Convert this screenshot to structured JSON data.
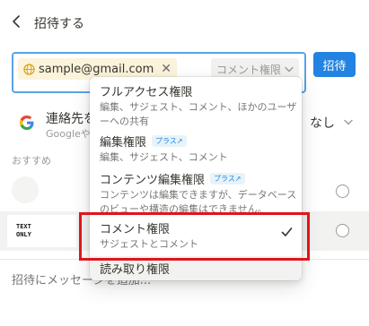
{
  "header": {
    "title": "招待する"
  },
  "invite": {
    "email": "sample@gmail.com",
    "remove_glyph": "✕",
    "permission": "コメント権限",
    "button": "招待"
  },
  "contacts": {
    "title": "連絡先を",
    "subtitle": "GoogleやS",
    "permission": "なし"
  },
  "recommended": {
    "label": "おすすめ"
  },
  "text_only_avatar": {
    "line1": "TEXT",
    "line2": "ONLY"
  },
  "message": {
    "placeholder": "招待にメッセージを追加..."
  },
  "dropdown": {
    "options": [
      {
        "title": "フルアクセス権限",
        "desc": "編集、サジェスト、コメント、ほかのユーザーへの共有"
      },
      {
        "title": "編集権限",
        "badge": "プラス↗",
        "desc": "編集、サジェスト、コメント"
      },
      {
        "title": "コンテンツ編集権限",
        "badge": "プラス↗",
        "desc": "コンテンツは編集できますが、データベースのビューや構造の編集はできません。"
      },
      {
        "title": "コメント権限",
        "desc": "サジェストとコメント",
        "selected": true
      },
      {
        "title": "読み取り権限"
      }
    ]
  },
  "colors": {
    "accent": "#2383e2",
    "chip_bg": "#fbf3db",
    "highlight": "#e0141c",
    "input_border": "#5aa3e6"
  },
  "icons": [
    "chevron-left-icon",
    "globe-icon",
    "chevron-down-icon",
    "google-logo",
    "check-icon"
  ]
}
